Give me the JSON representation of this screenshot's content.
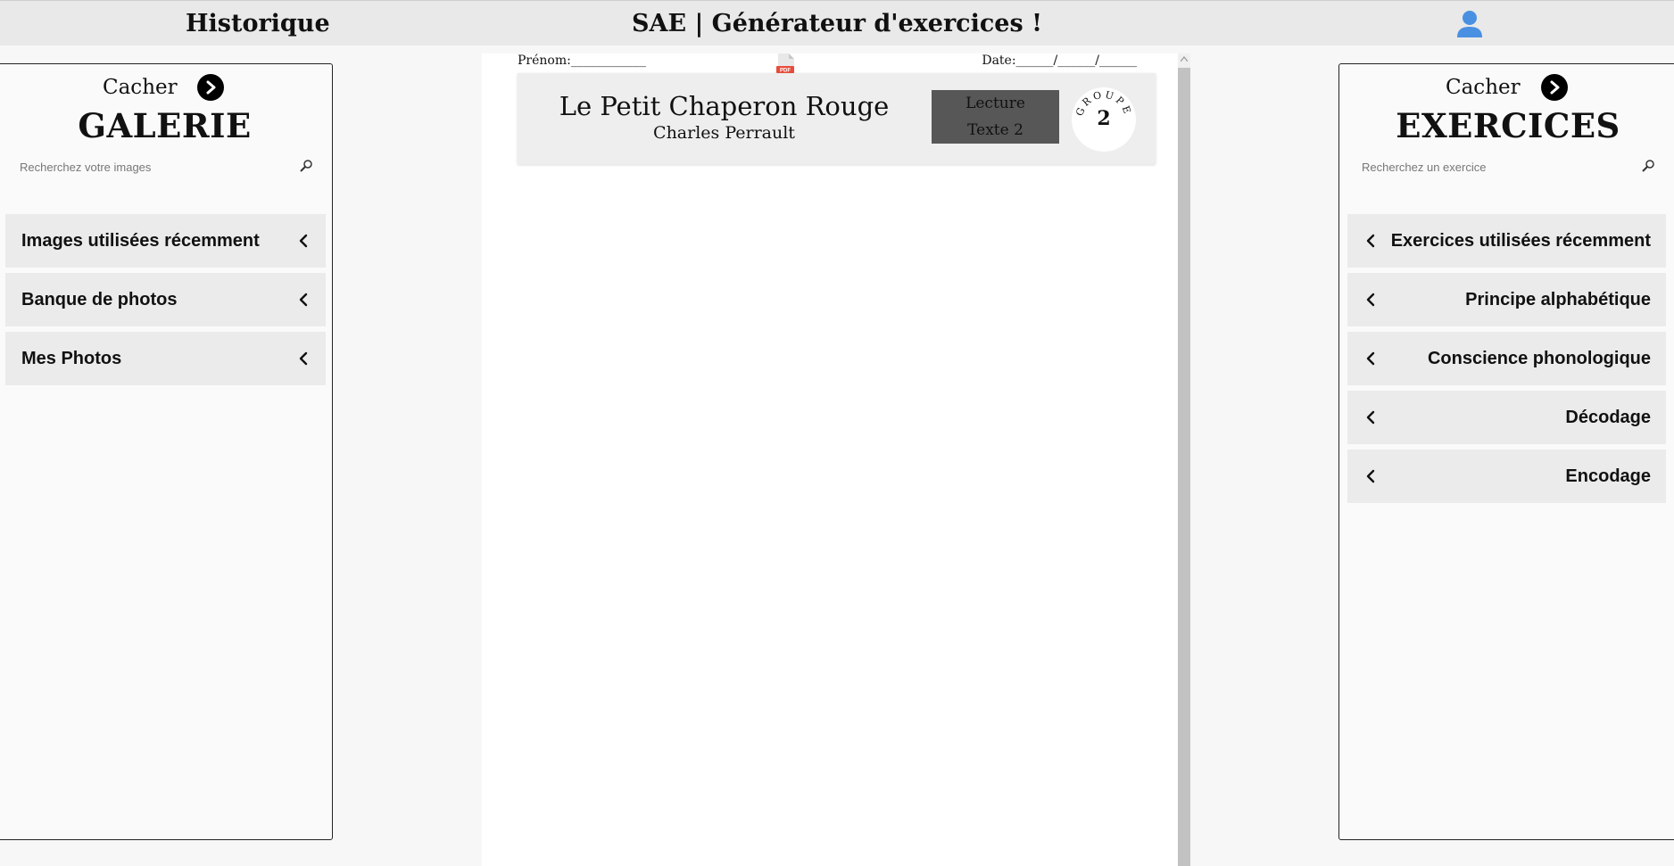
{
  "header": {
    "history_label": "Historique",
    "app_title": "SAE | Générateur d'exercices !",
    "accent_color": "#4a90e2"
  },
  "gallery": {
    "hide_label": "Cacher",
    "title": "GALERIE",
    "search_placeholder": "Recherchez votre images",
    "items": [
      {
        "label": "Images utilisées récemment"
      },
      {
        "label": "Banque de photos"
      },
      {
        "label": "Mes Photos"
      }
    ]
  },
  "exercises": {
    "hide_label": "Cacher",
    "title": "EXERCICES",
    "search_placeholder": "Recherchez un exercice",
    "items": [
      {
        "label": "Exercices utilisées récemment"
      },
      {
        "label": "Principe alphabétique"
      },
      {
        "label": "Conscience phonologique"
      },
      {
        "label": "Décodage"
      },
      {
        "label": "Encodage"
      }
    ]
  },
  "document": {
    "name_field": "Prénom:____________",
    "date_field": "Date:______/______/______",
    "pdf_icon_label": "PDF",
    "book_title": "Le Petit Chaperon Rouge",
    "author": "Charles Perrault",
    "level_line1": "Lecture",
    "level_line2": "Texte 2",
    "badge_word": "GROUPE",
    "badge_number": "2"
  }
}
